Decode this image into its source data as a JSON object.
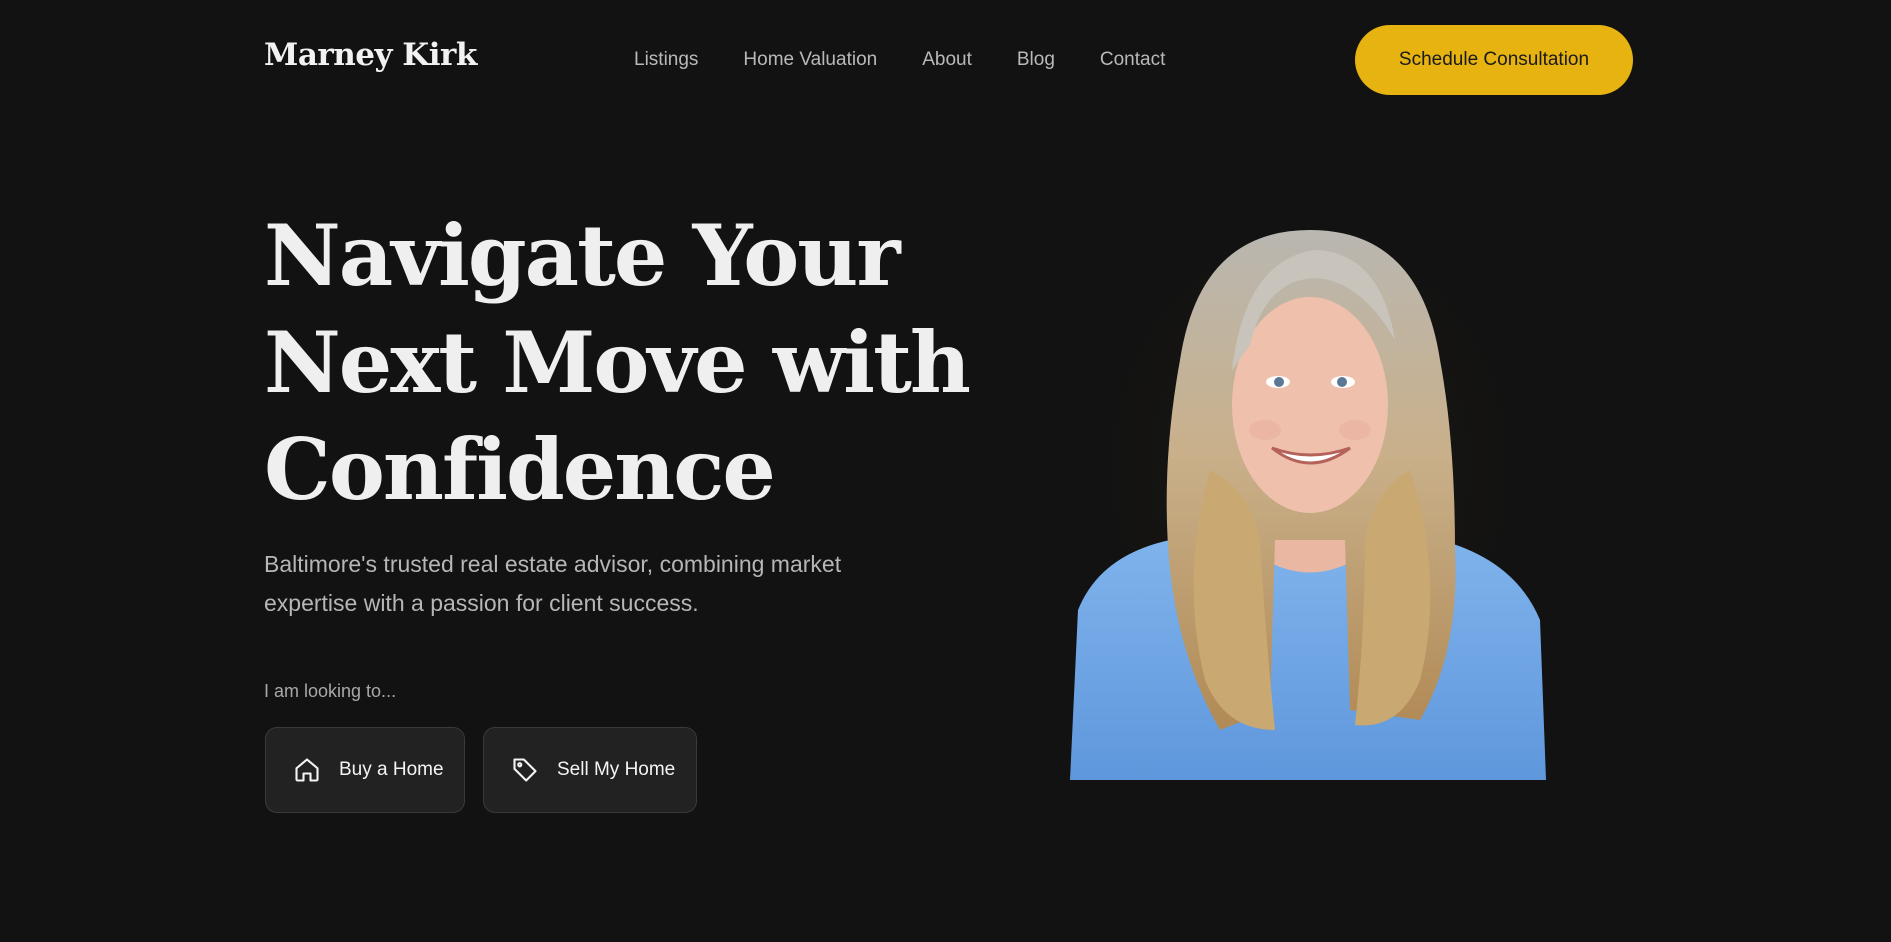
{
  "header": {
    "logo": "Marney Kirk",
    "nav": [
      "Listings",
      "Home Valuation",
      "About",
      "Blog",
      "Contact"
    ],
    "cta_label": "Schedule Consultation"
  },
  "hero": {
    "title_lines": [
      "Navigate Your",
      "Next Move with",
      "Confidence"
    ],
    "subtitle": "Baltimore's trusted real estate advisor, combining market expertise with a passion for client success.",
    "prompt": "I am looking to...",
    "options": [
      {
        "label": "Buy a Home",
        "icon": "home-icon"
      },
      {
        "label": "Sell My Home",
        "icon": "tag-icon"
      }
    ],
    "portrait": "agent-portrait"
  },
  "colors": {
    "background": "#121212",
    "accent": "#e6b311",
    "button_bg": "#222222",
    "text": "#eeeeee",
    "muted": "#b6b6b6"
  }
}
